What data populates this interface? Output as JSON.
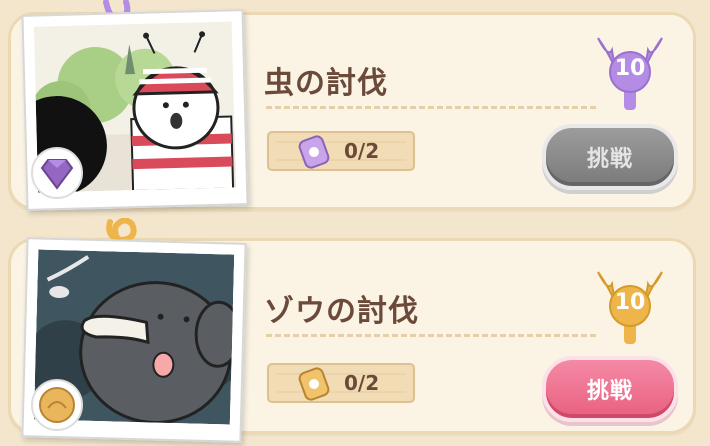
{
  "quests": [
    {
      "title": "虫の討伐",
      "progress": "0/2",
      "badge_value": "10",
      "badge_color": "#b48ce6",
      "button_label": "挑戦",
      "button_state": "disabled",
      "corner_icon": "gem-icon",
      "clip_icon": "purple-clip-icon"
    },
    {
      "title": "ゾウの討伐",
      "progress": "0/2",
      "badge_value": "10",
      "badge_color": "#eeb64a",
      "button_label": "挑戦",
      "button_state": "enabled",
      "corner_icon": "coin-icon",
      "clip_icon": "yellow-clip-icon"
    }
  ]
}
